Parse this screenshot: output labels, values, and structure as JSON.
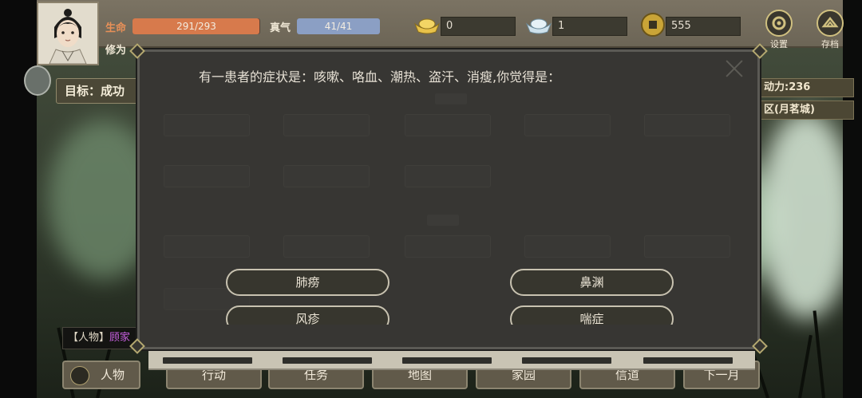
{
  "player": {
    "hp_label": "生命",
    "hp_value": "291/293",
    "hp_ratio": 0.993,
    "qi_label": "真气",
    "qi_value": "41/41",
    "qi_ratio": 1.0,
    "cultivation_label": "修为"
  },
  "currency": {
    "gold_ingot": "0",
    "silver_ingot": "1",
    "copper_coin": "555"
  },
  "top_buttons": {
    "settings": "设置",
    "save": "存档"
  },
  "goal": {
    "label": "目标：成功"
  },
  "right_info": {
    "energy": "动力:236",
    "location": "区(月茗城)"
  },
  "chat": {
    "prefix": "【人物】",
    "name": "顾家"
  },
  "bottom_nav": {
    "character": "人物",
    "action": "行动",
    "task": "任务",
    "map": "地图",
    "home": "家园",
    "letter": "信道",
    "next": "下一月"
  },
  "quiz": {
    "question": "有一患者的症状是：咳嗽、咯血、潮热、盗汗、消瘦,你觉得是：",
    "options": [
      "肺痨",
      "鼻渊",
      "风疹",
      "喘症"
    ]
  },
  "colors": {
    "hp": "#d77a4c",
    "qi": "#8b9fc4",
    "accent_gold": "#d0c080",
    "panel": "#373633"
  },
  "icons": {
    "settings": "gear-icon",
    "save": "save-icon",
    "gold": "gold-ingot-icon",
    "silver": "silver-ingot-icon",
    "copper": "copper-coin-icon",
    "character": "person-icon"
  }
}
